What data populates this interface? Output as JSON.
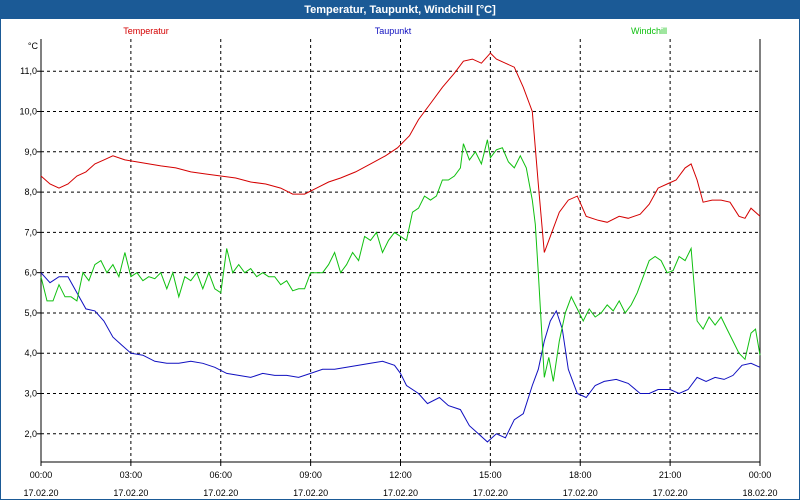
{
  "chart_data": {
    "type": "line",
    "title": "Temperatur, Taupunkt, Windchill [°C]",
    "ylabel": "°C",
    "xlabel": "",
    "ylim": [
      1.3,
      11.8
    ],
    "xlim": [
      0,
      24
    ],
    "grid": true,
    "legend_placement": "top",
    "y_ticks": [
      "2,0",
      "3,0",
      "4,0",
      "5,0",
      "6,0",
      "7,0",
      "8,0",
      "9,0",
      "10,0",
      "11,0"
    ],
    "y_tick_values": [
      2,
      3,
      4,
      5,
      6,
      7,
      8,
      9,
      10,
      11
    ],
    "x_ticks": [
      {
        "time": "00:00",
        "date": "17.02.20",
        "hour": 0
      },
      {
        "time": "03:00",
        "date": "17.02.20",
        "hour": 3
      },
      {
        "time": "06:00",
        "date": "17.02.20",
        "hour": 6
      },
      {
        "time": "09:00",
        "date": "17.02.20",
        "hour": 9
      },
      {
        "time": "12:00",
        "date": "17.02.20",
        "hour": 12
      },
      {
        "time": "15:00",
        "date": "17.02.20",
        "hour": 15
      },
      {
        "time": "18:00",
        "date": "17.02.20",
        "hour": 18
      },
      {
        "time": "21:00",
        "date": "17.02.20",
        "hour": 21
      },
      {
        "time": "00:00",
        "date": "18.02.20",
        "hour": 24
      }
    ],
    "series": [
      {
        "name": "Temperatur",
        "color": "#d40000",
        "points": [
          [
            0,
            8.4
          ],
          [
            0.3,
            8.2
          ],
          [
            0.6,
            8.1
          ],
          [
            0.9,
            8.2
          ],
          [
            1.2,
            8.4
          ],
          [
            1.5,
            8.5
          ],
          [
            1.8,
            8.7
          ],
          [
            2.1,
            8.8
          ],
          [
            2.4,
            8.9
          ],
          [
            2.8,
            8.8
          ],
          [
            3.2,
            8.75
          ],
          [
            3.6,
            8.7
          ],
          [
            4.0,
            8.65
          ],
          [
            4.5,
            8.6
          ],
          [
            5.0,
            8.5
          ],
          [
            5.5,
            8.45
          ],
          [
            6.0,
            8.4
          ],
          [
            6.5,
            8.35
          ],
          [
            7.0,
            8.25
          ],
          [
            7.5,
            8.2
          ],
          [
            8.0,
            8.1
          ],
          [
            8.4,
            7.95
          ],
          [
            8.8,
            7.95
          ],
          [
            9.2,
            8.1
          ],
          [
            9.6,
            8.25
          ],
          [
            10.0,
            8.35
          ],
          [
            10.5,
            8.5
          ],
          [
            11.0,
            8.7
          ],
          [
            11.5,
            8.9
          ],
          [
            11.9,
            9.1
          ],
          [
            12.3,
            9.4
          ],
          [
            12.6,
            9.8
          ],
          [
            13.0,
            10.2
          ],
          [
            13.4,
            10.6
          ],
          [
            13.8,
            10.95
          ],
          [
            14.1,
            11.25
          ],
          [
            14.4,
            11.3
          ],
          [
            14.7,
            11.2
          ],
          [
            15.0,
            11.45
          ],
          [
            15.2,
            11.3
          ],
          [
            15.5,
            11.2
          ],
          [
            15.8,
            11.1
          ],
          [
            16.1,
            10.6
          ],
          [
            16.4,
            10.0
          ],
          [
            16.6,
            8.2
          ],
          [
            16.8,
            6.5
          ],
          [
            17.0,
            6.9
          ],
          [
            17.3,
            7.5
          ],
          [
            17.6,
            7.8
          ],
          [
            17.9,
            7.9
          ],
          [
            18.2,
            7.4
          ],
          [
            18.6,
            7.3
          ],
          [
            18.9,
            7.25
          ],
          [
            19.3,
            7.4
          ],
          [
            19.6,
            7.35
          ],
          [
            20.0,
            7.45
          ],
          [
            20.3,
            7.7
          ],
          [
            20.6,
            8.1
          ],
          [
            20.9,
            8.2
          ],
          [
            21.2,
            8.3
          ],
          [
            21.5,
            8.6
          ],
          [
            21.7,
            8.7
          ],
          [
            21.9,
            8.3
          ],
          [
            22.1,
            7.75
          ],
          [
            22.4,
            7.8
          ],
          [
            22.7,
            7.8
          ],
          [
            23.0,
            7.75
          ],
          [
            23.3,
            7.4
          ],
          [
            23.5,
            7.35
          ],
          [
            23.7,
            7.6
          ],
          [
            24,
            7.4
          ]
        ]
      },
      {
        "name": "Taupunkt",
        "color": "#1010c0",
        "points": [
          [
            0,
            6.0
          ],
          [
            0.3,
            5.75
          ],
          [
            0.6,
            5.9
          ],
          [
            0.9,
            5.9
          ],
          [
            1.2,
            5.5
          ],
          [
            1.5,
            5.1
          ],
          [
            1.8,
            5.05
          ],
          [
            2.1,
            4.8
          ],
          [
            2.4,
            4.4
          ],
          [
            2.7,
            4.2
          ],
          [
            3.0,
            4.0
          ],
          [
            3.4,
            3.95
          ],
          [
            3.8,
            3.8
          ],
          [
            4.2,
            3.75
          ],
          [
            4.6,
            3.75
          ],
          [
            5.0,
            3.8
          ],
          [
            5.4,
            3.75
          ],
          [
            5.8,
            3.65
          ],
          [
            6.2,
            3.5
          ],
          [
            6.6,
            3.45
          ],
          [
            7.0,
            3.4
          ],
          [
            7.4,
            3.5
          ],
          [
            7.8,
            3.45
          ],
          [
            8.2,
            3.45
          ],
          [
            8.6,
            3.4
          ],
          [
            9.0,
            3.5
          ],
          [
            9.4,
            3.6
          ],
          [
            9.8,
            3.6
          ],
          [
            10.2,
            3.65
          ],
          [
            10.6,
            3.7
          ],
          [
            11.0,
            3.75
          ],
          [
            11.4,
            3.8
          ],
          [
            11.8,
            3.7
          ],
          [
            12.0,
            3.5
          ],
          [
            12.2,
            3.2
          ],
          [
            12.6,
            3.0
          ],
          [
            12.9,
            2.75
          ],
          [
            13.3,
            2.9
          ],
          [
            13.6,
            2.7
          ],
          [
            14.0,
            2.6
          ],
          [
            14.3,
            2.2
          ],
          [
            14.6,
            2.0
          ],
          [
            14.9,
            1.8
          ],
          [
            15.2,
            2.0
          ],
          [
            15.5,
            1.9
          ],
          [
            15.8,
            2.35
          ],
          [
            16.1,
            2.5
          ],
          [
            16.4,
            3.2
          ],
          [
            16.6,
            3.6
          ],
          [
            16.8,
            4.3
          ],
          [
            17.0,
            4.8
          ],
          [
            17.2,
            5.05
          ],
          [
            17.4,
            4.6
          ],
          [
            17.6,
            3.6
          ],
          [
            17.9,
            3.0
          ],
          [
            18.2,
            2.9
          ],
          [
            18.5,
            3.2
          ],
          [
            18.8,
            3.3
          ],
          [
            19.2,
            3.35
          ],
          [
            19.6,
            3.25
          ],
          [
            20.0,
            3.0
          ],
          [
            20.3,
            3.0
          ],
          [
            20.6,
            3.1
          ],
          [
            21.0,
            3.1
          ],
          [
            21.3,
            3.0
          ],
          [
            21.6,
            3.1
          ],
          [
            21.9,
            3.4
          ],
          [
            22.2,
            3.3
          ],
          [
            22.5,
            3.4
          ],
          [
            22.8,
            3.35
          ],
          [
            23.1,
            3.45
          ],
          [
            23.4,
            3.7
          ],
          [
            23.7,
            3.75
          ],
          [
            24,
            3.65
          ]
        ]
      },
      {
        "name": "Windchill",
        "color": "#10c010",
        "points": [
          [
            0,
            5.9
          ],
          [
            0.2,
            5.3
          ],
          [
            0.4,
            5.3
          ],
          [
            0.6,
            5.7
          ],
          [
            0.8,
            5.4
          ],
          [
            1.0,
            5.4
          ],
          [
            1.2,
            5.3
          ],
          [
            1.4,
            6.0
          ],
          [
            1.6,
            5.8
          ],
          [
            1.8,
            6.2
          ],
          [
            2.0,
            6.3
          ],
          [
            2.2,
            6.0
          ],
          [
            2.4,
            6.2
          ],
          [
            2.6,
            5.9
          ],
          [
            2.8,
            6.5
          ],
          [
            3.0,
            5.9
          ],
          [
            3.2,
            6.0
          ],
          [
            3.4,
            5.8
          ],
          [
            3.6,
            5.9
          ],
          [
            3.8,
            5.85
          ],
          [
            4.0,
            6.0
          ],
          [
            4.2,
            5.6
          ],
          [
            4.4,
            6.0
          ],
          [
            4.6,
            5.4
          ],
          [
            4.8,
            5.9
          ],
          [
            5.0,
            5.8
          ],
          [
            5.2,
            6.0
          ],
          [
            5.4,
            5.6
          ],
          [
            5.6,
            6.0
          ],
          [
            5.8,
            5.6
          ],
          [
            6.0,
            5.5
          ],
          [
            6.2,
            6.6
          ],
          [
            6.4,
            6.0
          ],
          [
            6.6,
            6.2
          ],
          [
            6.8,
            6.0
          ],
          [
            7.0,
            6.1
          ],
          [
            7.2,
            5.9
          ],
          [
            7.4,
            6.0
          ],
          [
            7.6,
            5.9
          ],
          [
            7.8,
            5.9
          ],
          [
            8.0,
            5.7
          ],
          [
            8.2,
            5.8
          ],
          [
            8.4,
            5.55
          ],
          [
            8.6,
            5.6
          ],
          [
            8.8,
            5.6
          ],
          [
            9.0,
            6.0
          ],
          [
            9.2,
            6.0
          ],
          [
            9.4,
            6.0
          ],
          [
            9.6,
            6.2
          ],
          [
            9.8,
            6.5
          ],
          [
            10.0,
            6.0
          ],
          [
            10.2,
            6.2
          ],
          [
            10.4,
            6.5
          ],
          [
            10.6,
            6.3
          ],
          [
            10.8,
            6.9
          ],
          [
            11.0,
            6.8
          ],
          [
            11.2,
            7.0
          ],
          [
            11.4,
            6.5
          ],
          [
            11.6,
            6.8
          ],
          [
            11.8,
            7.0
          ],
          [
            12.0,
            6.9
          ],
          [
            12.2,
            6.8
          ],
          [
            12.4,
            7.5
          ],
          [
            12.6,
            7.6
          ],
          [
            12.8,
            7.9
          ],
          [
            13.0,
            7.8
          ],
          [
            13.2,
            7.9
          ],
          [
            13.4,
            8.3
          ],
          [
            13.6,
            8.3
          ],
          [
            13.8,
            8.4
          ],
          [
            14.0,
            8.6
          ],
          [
            14.1,
            9.2
          ],
          [
            14.3,
            8.8
          ],
          [
            14.5,
            9.0
          ],
          [
            14.7,
            8.7
          ],
          [
            14.9,
            9.3
          ],
          [
            15.0,
            8.85
          ],
          [
            15.2,
            9.05
          ],
          [
            15.4,
            9.1
          ],
          [
            15.6,
            8.75
          ],
          [
            15.8,
            8.6
          ],
          [
            16.0,
            8.9
          ],
          [
            16.2,
            8.6
          ],
          [
            16.4,
            7.8
          ],
          [
            16.5,
            7.2
          ],
          [
            16.6,
            6.0
          ],
          [
            16.7,
            4.7
          ],
          [
            16.8,
            3.4
          ],
          [
            16.95,
            3.9
          ],
          [
            17.1,
            3.3
          ],
          [
            17.3,
            4.3
          ],
          [
            17.5,
            5.0
          ],
          [
            17.7,
            5.4
          ],
          [
            17.9,
            5.1
          ],
          [
            18.1,
            4.8
          ],
          [
            18.3,
            5.1
          ],
          [
            18.5,
            4.9
          ],
          [
            18.7,
            5.0
          ],
          [
            18.9,
            5.2
          ],
          [
            19.1,
            5.05
          ],
          [
            19.3,
            5.3
          ],
          [
            19.5,
            5.0
          ],
          [
            19.7,
            5.2
          ],
          [
            19.9,
            5.5
          ],
          [
            20.1,
            5.9
          ],
          [
            20.3,
            6.3
          ],
          [
            20.5,
            6.4
          ],
          [
            20.7,
            6.3
          ],
          [
            20.9,
            6.0
          ],
          [
            21.1,
            6.05
          ],
          [
            21.3,
            6.4
          ],
          [
            21.5,
            6.3
          ],
          [
            21.7,
            6.6
          ],
          [
            21.9,
            4.8
          ],
          [
            22.1,
            4.6
          ],
          [
            22.3,
            4.9
          ],
          [
            22.5,
            4.7
          ],
          [
            22.7,
            4.9
          ],
          [
            22.9,
            4.6
          ],
          [
            23.1,
            4.3
          ],
          [
            23.3,
            4.0
          ],
          [
            23.5,
            3.85
          ],
          [
            23.7,
            4.5
          ],
          [
            23.85,
            4.6
          ],
          [
            24,
            3.95
          ]
        ]
      }
    ]
  },
  "colors": {
    "titlebar": "#1b5a96",
    "grid": "#000000",
    "axis": "#000000"
  }
}
